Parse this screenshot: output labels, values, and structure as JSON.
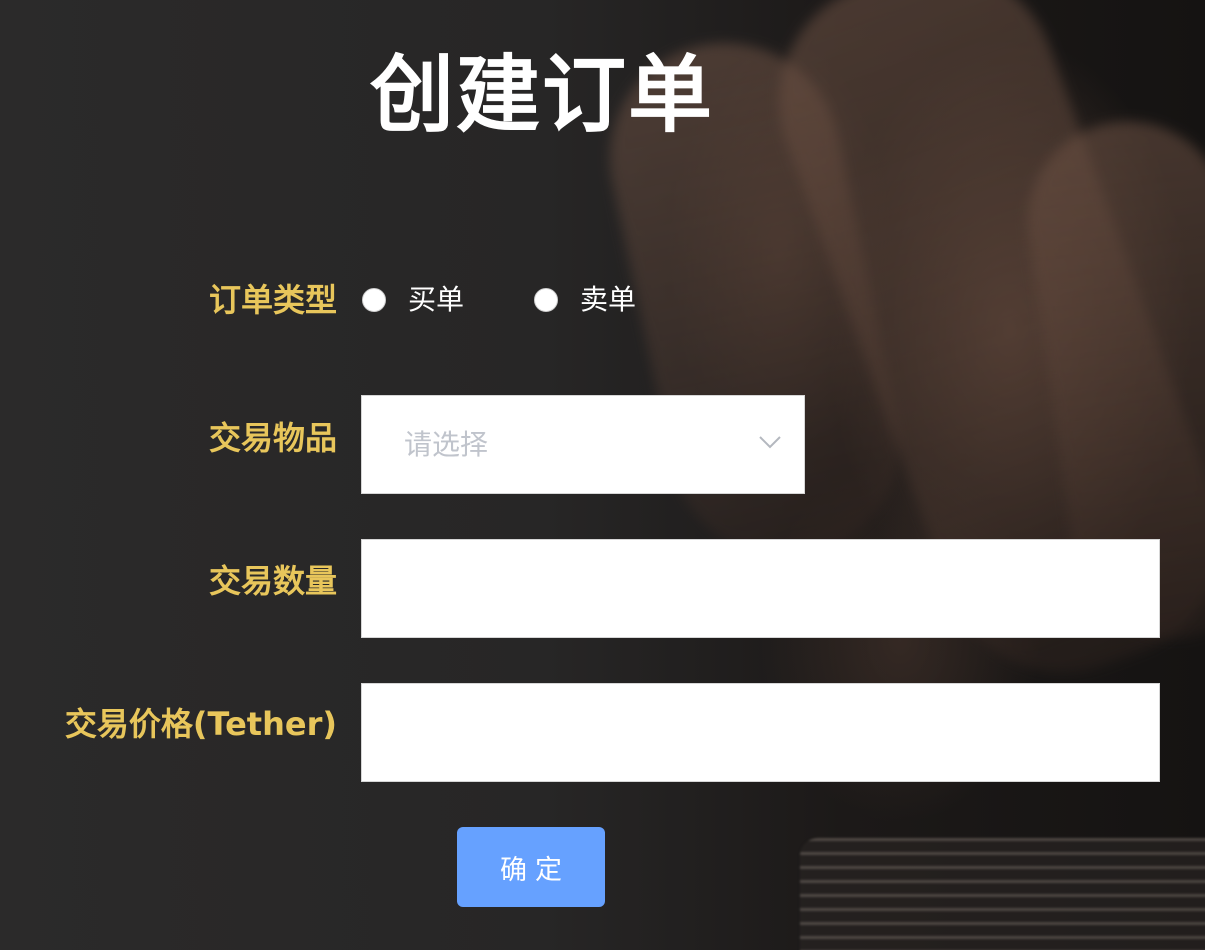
{
  "page": {
    "title": "创建订单"
  },
  "form": {
    "order_type": {
      "label": "订单类型",
      "options": [
        "买单",
        "卖单"
      ],
      "selected": null
    },
    "item": {
      "label": "交易物品",
      "placeholder": "请选择",
      "value": ""
    },
    "quantity": {
      "label": "交易数量",
      "value": ""
    },
    "price": {
      "label": "交易价格(Tether)",
      "value": ""
    },
    "submit_label": "确定"
  },
  "colors": {
    "label": "#e8c65b",
    "button": "#66a1ff",
    "title": "#ffffff",
    "placeholder": "#c0c4cc"
  },
  "icons": {
    "select_arrow": "chevron-down-icon"
  }
}
